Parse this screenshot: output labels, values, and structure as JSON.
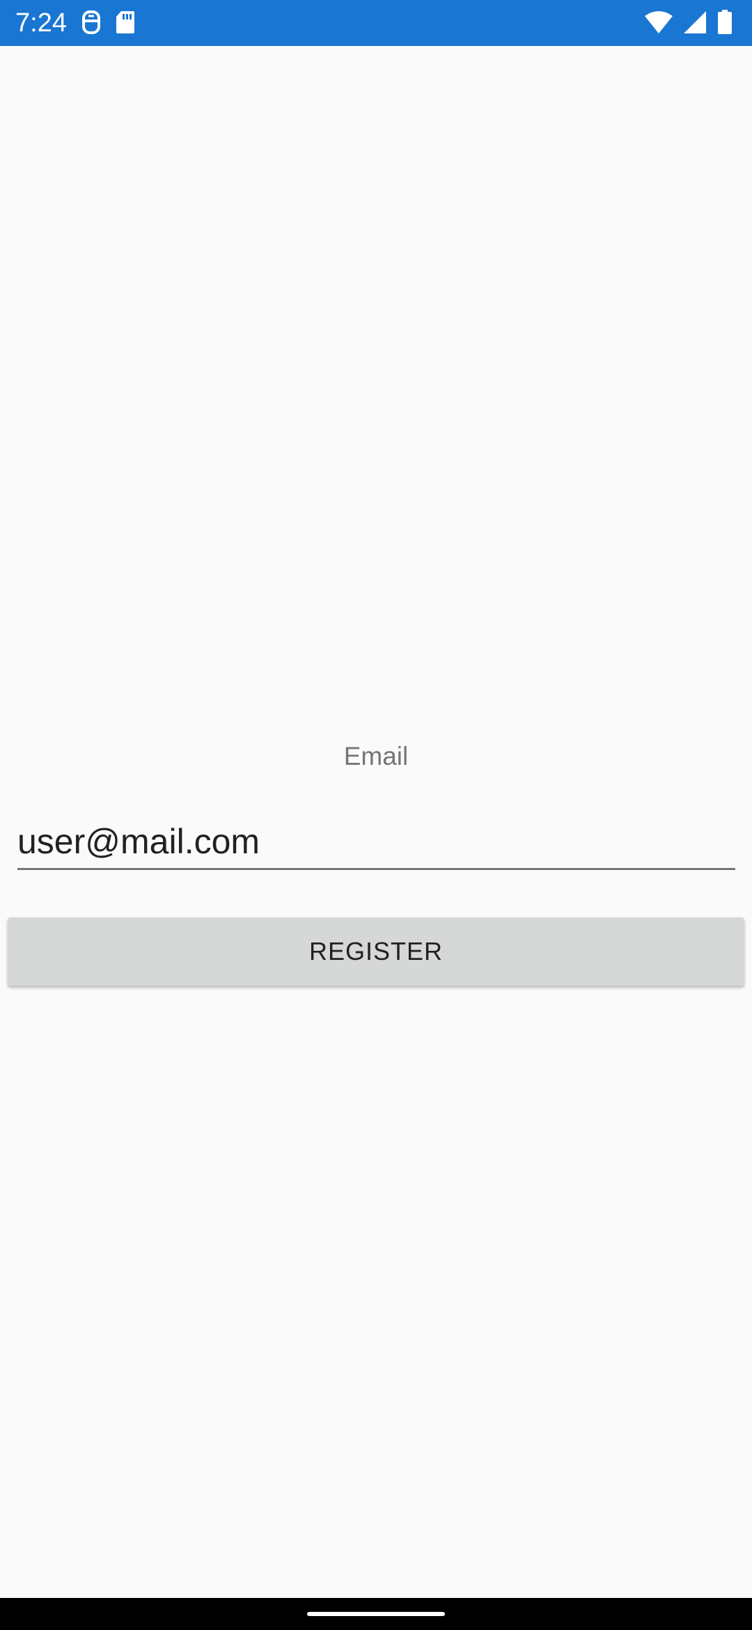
{
  "status_bar": {
    "time": "7:24",
    "background_color": "#1976d2",
    "left_icons": [
      "notification-robot-icon",
      "sd-card-icon"
    ],
    "right_icons": [
      "wifi-icon",
      "cell-signal-icon",
      "battery-icon"
    ]
  },
  "form": {
    "email_label": "Email",
    "email_value": "user@mail.com",
    "register_label": "REGISTER"
  },
  "colors": {
    "background": "#fafafa",
    "button": "#d6d7d7",
    "label": "#757575"
  }
}
